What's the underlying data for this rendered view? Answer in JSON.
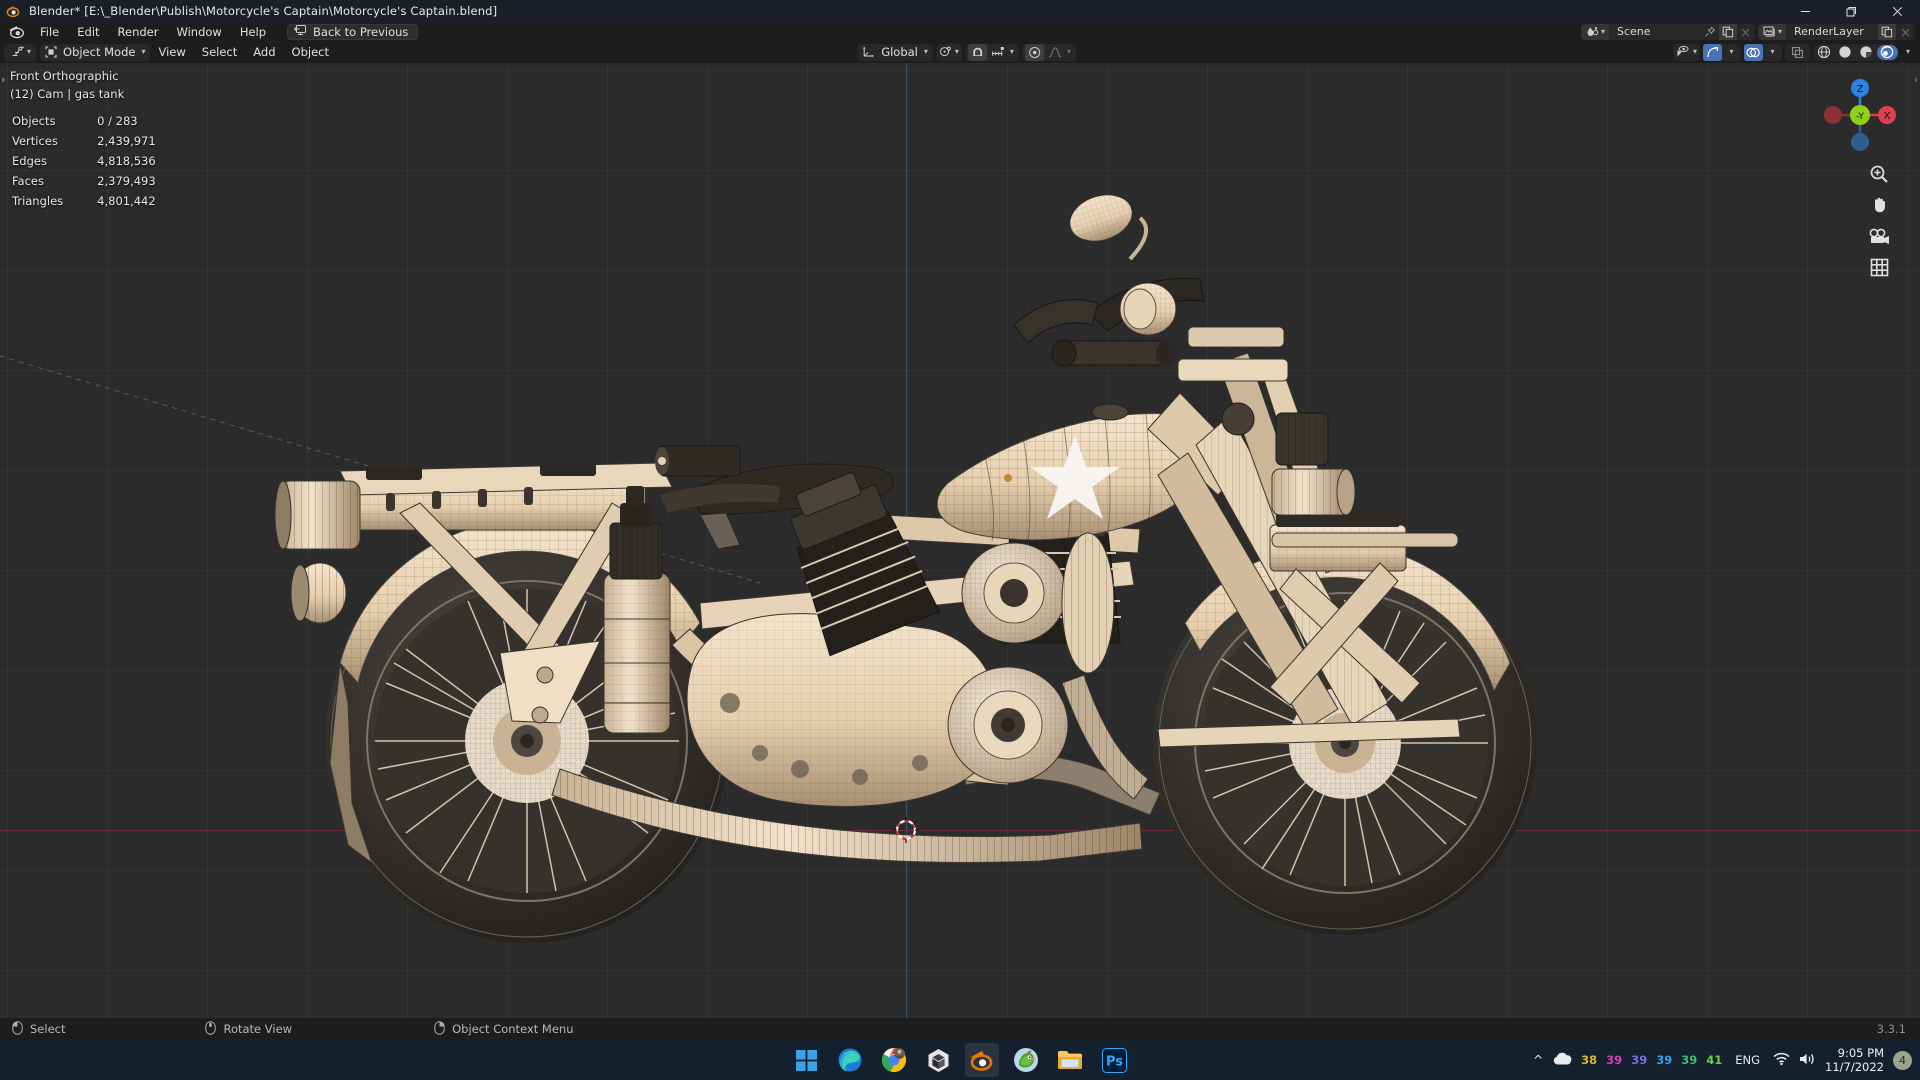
{
  "window": {
    "title": "Blender* [E:\\_Blender\\Publish\\Motorcycle's Captain\\Motorcycle's Captain.blend]",
    "app_icon": "blender-icon",
    "controls": {
      "minimize": "—",
      "maximize": "❐",
      "close": "✕"
    }
  },
  "topbar": {
    "logo_icon": "blender-logo-icon",
    "menus": [
      {
        "label": "File",
        "name": "menu-file"
      },
      {
        "label": "Edit",
        "name": "menu-edit"
      },
      {
        "label": "Render",
        "name": "menu-render"
      },
      {
        "label": "Window",
        "name": "menu-window"
      },
      {
        "label": "Help",
        "name": "menu-help"
      }
    ],
    "back_to_previous": {
      "label": "Back to Previous",
      "icon": "back-to-previous-icon"
    },
    "scene": {
      "icon": "scene-datablock-icon",
      "value": "Scene",
      "pin_icon": "pin-icon",
      "new_icon": "new-copy-icon",
      "unlink_icon": "unlink-x-icon"
    },
    "view_layer": {
      "icon": "renderlayer-datablock-icon",
      "value": "RenderLayer",
      "new_icon": "new-copy-icon",
      "unlink_icon": "unlink-x-icon"
    }
  },
  "viewport_header": {
    "editor_type_icon": "editor-type-3dview-icon",
    "mode": {
      "icon": "object-mode-icon",
      "label": "Object Mode"
    },
    "menus": [
      {
        "label": "View",
        "name": "viewport-menu-view"
      },
      {
        "label": "Select",
        "name": "viewport-menu-select"
      },
      {
        "label": "Add",
        "name": "viewport-menu-add"
      },
      {
        "label": "Object",
        "name": "viewport-menu-object"
      }
    ],
    "transform_orientation": {
      "icon": "transform-orientation-icon",
      "label": "Global"
    },
    "pivot_point": {
      "icon": "pivot-point-icon"
    },
    "snap": {
      "magnet_icon": "magnet-icon",
      "snap_to_icon": "snap-increment-icon",
      "enabled": true
    },
    "proportional_edit": {
      "icon": "proportional-edit-icon",
      "falloff_icon": "falloff-smooth-icon"
    },
    "visibility": {
      "icon": "object-visibility-icon"
    },
    "gizmo": {
      "icon": "gizmo-icon",
      "enabled": true
    },
    "overlays": {
      "icon": "overlays-icon",
      "enabled": true
    },
    "xray": {
      "icon": "xray-icon",
      "enabled": false
    },
    "shading_modes": [
      {
        "name": "shading-wireframe",
        "icon": "wireframe-sphere-icon",
        "active": false
      },
      {
        "name": "shading-solid",
        "icon": "solid-sphere-icon",
        "active": false
      },
      {
        "name": "shading-material-preview",
        "icon": "material-sphere-icon",
        "active": false
      },
      {
        "name": "shading-rendered",
        "icon": "rendered-sphere-icon",
        "active": true
      }
    ]
  },
  "viewport": {
    "view_name": "Front Orthographic",
    "active_object": "(12) Cam | gas tank",
    "stats": [
      {
        "label": "Objects",
        "value": "0 / 283"
      },
      {
        "label": "Vertices",
        "value": "2,439,971"
      },
      {
        "label": "Edges",
        "value": "4,818,536"
      },
      {
        "label": "Faces",
        "value": "2,379,493"
      },
      {
        "label": "Triangles",
        "value": "4,801,442"
      }
    ],
    "colors": {
      "background": "#2b2b2b",
      "axis_x": "#6b2d36",
      "axis_z": "#2c4f6b",
      "model_light": "#efdcc4",
      "model_dark": "#2a2723"
    },
    "nav_gizmo": {
      "axes": [
        {
          "label": "Z",
          "name": "gizmo-axis-z",
          "color": "#2f83e3"
        },
        {
          "label": "X",
          "name": "gizmo-axis-x",
          "color": "#e0404e"
        },
        {
          "label": "-Y",
          "name": "gizmo-axis-neg-y",
          "color": "#8dd21a"
        }
      ],
      "tools": [
        {
          "name": "zoom-view-icon"
        },
        {
          "name": "pan-view-icon"
        },
        {
          "name": "camera-view-icon"
        },
        {
          "name": "toggle-ortho-persp-icon"
        }
      ]
    },
    "sidebar_toggle_left": "›",
    "sidebar_toggle_right": "‹",
    "scene_description": "Wireframe-overlaid 3D model of a vintage military motorcycle in front orthographic view, beige/tan bodywork with a white star on the gas tank, dark engine and spoked wheels."
  },
  "statusbar": {
    "hints": [
      {
        "icon": "mouse-left-icon",
        "label": "Select"
      },
      {
        "icon": "mouse-middle-icon",
        "label": "Rotate View"
      },
      {
        "icon": "mouse-right-icon",
        "label": "Object Context Menu"
      }
    ],
    "version": "3.3.1"
  },
  "taskbar": {
    "apps": [
      {
        "name": "taskbar-start-button",
        "icon": "windows-start-icon",
        "active": false,
        "running": false
      },
      {
        "name": "taskbar-edge",
        "icon": "microsoft-edge-icon",
        "active": false,
        "running": true
      },
      {
        "name": "taskbar-chrome",
        "icon": "google-chrome-icon",
        "active": false,
        "running": true
      },
      {
        "name": "taskbar-unity",
        "icon": "unity-icon",
        "active": false,
        "running": true
      },
      {
        "name": "taskbar-blender",
        "icon": "blender-icon",
        "active": true,
        "running": true
      },
      {
        "name": "taskbar-parrot-app",
        "icon": "parrot-app-icon",
        "active": false,
        "running": true
      },
      {
        "name": "taskbar-file-explorer",
        "icon": "file-explorer-icon",
        "active": false,
        "running": true
      },
      {
        "name": "taskbar-photoshop",
        "icon": "photoshop-icon",
        "active": false,
        "running": true
      }
    ],
    "tray": {
      "overflow_icon": "chevron-up-icon",
      "cloud_icon": "onedrive-icon",
      "monitor_values": [
        {
          "value": "38",
          "color": "#d6b83c"
        },
        {
          "value": "39",
          "color": "#d040b8"
        },
        {
          "value": "39",
          "color": "#7b6fe0"
        },
        {
          "value": "39",
          "color": "#3da0e0"
        },
        {
          "value": "39",
          "color": "#3fc06a"
        },
        {
          "value": "41",
          "color": "#6fd03f"
        }
      ],
      "language": "ENG",
      "wifi_icon": "wifi-icon",
      "volume_icon": "speaker-icon",
      "time": "9:05 PM",
      "date": "11/7/2022",
      "badge": "4"
    }
  }
}
